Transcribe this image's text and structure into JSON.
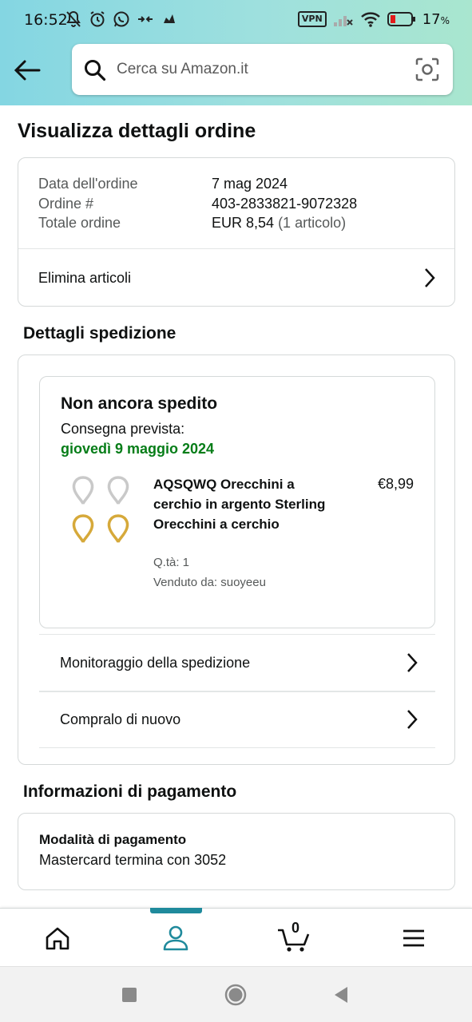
{
  "status_bar": {
    "time": "16:52",
    "vpn_label": "VPN",
    "battery_percent": "17",
    "battery_unit": "%"
  },
  "header": {
    "search_placeholder": "Cerca su Amazon.it",
    "icons": [
      "back-arrow-icon",
      "search-icon",
      "camera-lens-icon"
    ]
  },
  "page_title": "Visualizza dettagli ordine",
  "order_summary": {
    "rows": [
      {
        "label": "Data dell'ordine",
        "value": "7 mag 2024"
      },
      {
        "label": "Ordine #",
        "value": "403-2833821-9072328"
      },
      {
        "label": "Totale ordine",
        "value": "EUR 8,54",
        "extra": "(1 articolo)"
      }
    ],
    "delete_items_label": "Elimina articoli"
  },
  "shipping": {
    "section_title": "Dettagli spedizione",
    "status": "Non ancora spedito",
    "delivery_label": "Consegna prevista:",
    "delivery_date": "giovedì 9 maggio 2024",
    "product": {
      "title": "AQSQWQ Orecchini a cerchio in argento Sterling Orecchini a cerchio",
      "price": "€8,99",
      "quantity": "Q.tà: 1",
      "seller": "Venduto da: suoyeeu"
    },
    "links": [
      {
        "label": "Monitoraggio della spedizione"
      },
      {
        "label": "Compralo di nuovo"
      }
    ]
  },
  "payment": {
    "section_title": "Informazioni di pagamento",
    "method_title": "Modalità di pagamento",
    "method_value": "Mastercard  termina con 3052"
  },
  "bottom_nav": {
    "items": [
      "home-icon",
      "account-icon",
      "cart-icon",
      "menu-icon"
    ],
    "active": "account-icon",
    "cart_count": "0"
  },
  "colors": {
    "accent": "#1f8a9c",
    "delivery_green": "#067d18",
    "header_gradient_start": "#84d6e2",
    "header_gradient_end": "#a9e6cf"
  }
}
